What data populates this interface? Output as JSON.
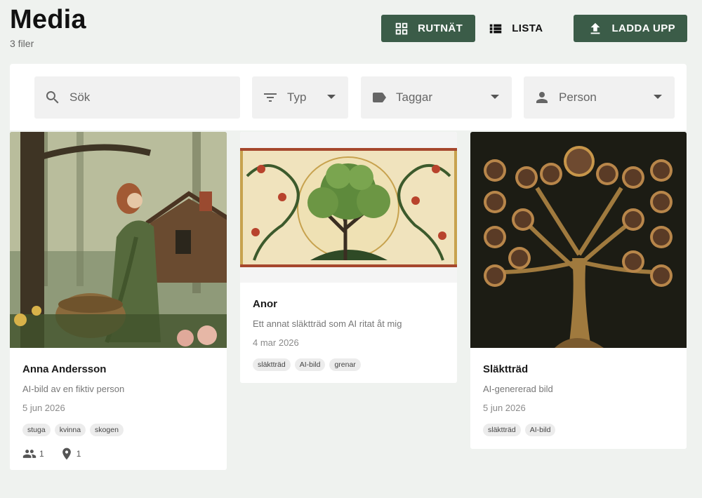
{
  "page": {
    "title": "Media",
    "file_count": "3 filer"
  },
  "toolbar": {
    "grid_label": "RUTNÄT",
    "list_label": "LISTA",
    "upload_label": "LADDA UPP",
    "accent_color": "#3b5c48"
  },
  "filters": {
    "search_placeholder": "Sök",
    "type_label": "Typ",
    "tags_label": "Taggar",
    "person_label": "Person"
  },
  "cards": [
    {
      "title": "Anna Andersson",
      "description": "AI-bild av en fiktiv person",
      "date": "5 jun 2026",
      "tags": [
        "stuga",
        "kvinna",
        "skogen"
      ],
      "persons_count": "1",
      "places_count": "1"
    },
    {
      "title": "Anor",
      "description": "Ett annat släktträd som AI ritat åt mig",
      "date": "4 mar 2026",
      "tags": [
        "släktträd",
        "AI-bild",
        "grenar"
      ]
    },
    {
      "title": "Släktträd",
      "description": "AI-genererad bild",
      "date": "5 jun 2026",
      "tags": [
        "släktträd",
        "AI-bild"
      ]
    }
  ]
}
